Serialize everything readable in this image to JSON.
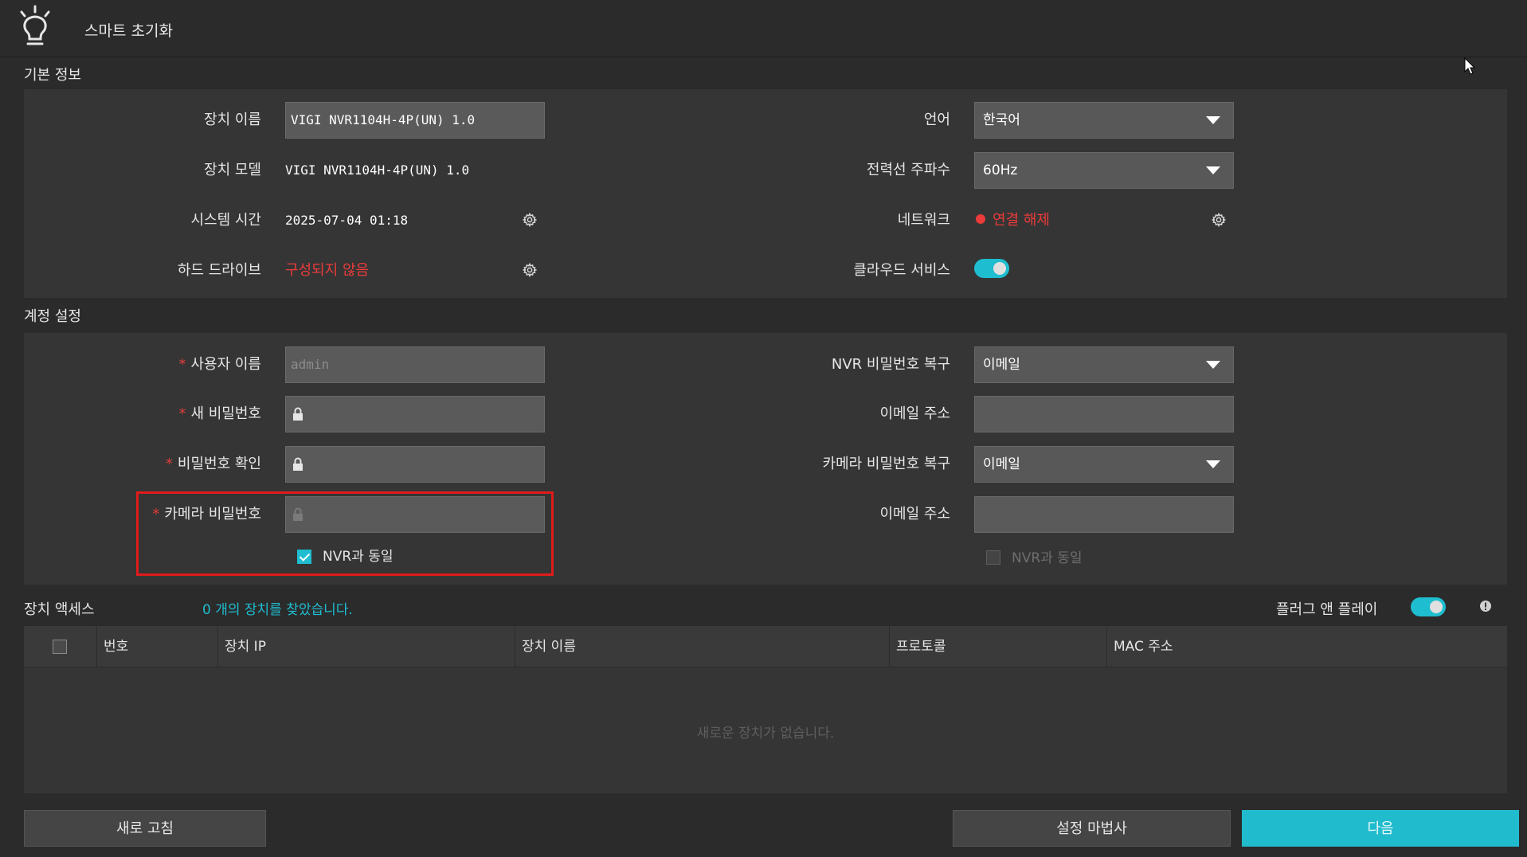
{
  "header": {
    "title": "스마트 초기화"
  },
  "basic_info": {
    "section_title": "기본 정보",
    "device_name": {
      "label": "장치 이름",
      "value": "VIGI NVR1104H-4P(UN) 1.0"
    },
    "device_model": {
      "label": "장치 모델",
      "value": "VIGI NVR1104H-4P(UN) 1.0"
    },
    "system_time": {
      "label": "시스템 시간",
      "value": "2025-07-04 01:18"
    },
    "hard_drive": {
      "label": "하드 드라이브",
      "value": "구성되지 않음"
    },
    "language": {
      "label": "언어",
      "value": "한국어"
    },
    "power_frequency": {
      "label": "전력선 주파수",
      "value": "60Hz"
    },
    "network": {
      "label": "네트워크",
      "value": "연결 해제"
    },
    "cloud_service": {
      "label": "클라우드 서비스",
      "enabled": true
    }
  },
  "account": {
    "section_title": "계정 설정",
    "required_mark": "*",
    "username": {
      "label": "사용자 이름",
      "value": "admin"
    },
    "new_password": {
      "label": "새 비밀번호",
      "value": ""
    },
    "confirm_password": {
      "label": "비밀번호 확인",
      "value": ""
    },
    "camera_password": {
      "label": "카메라 비밀번호",
      "value": ""
    },
    "same_as_nvr_left": {
      "label": "NVR과 동일",
      "checked": true
    },
    "nvr_recovery": {
      "label": "NVR 비밀번호 복구",
      "value": "이메일"
    },
    "email1": {
      "label": "이메일 주소",
      "value": ""
    },
    "camera_recovery": {
      "label": "카메라 비밀번호 복구",
      "value": "이메일"
    },
    "email2": {
      "label": "이메일 주소",
      "value": ""
    },
    "same_as_nvr_right": {
      "label": "NVR과 동일",
      "checked": false
    }
  },
  "device_access": {
    "section_title": "장치 액세스",
    "found_message": "0 개의 장치를 찾았습니다.",
    "plug_and_play": {
      "label": "플러그 앤 플레이",
      "enabled": true
    },
    "columns": [
      "번호",
      "장치 IP",
      "장치 이름",
      "프로토콜",
      "MAC 주소"
    ],
    "rows": [],
    "empty_message": "새로운 장치가 없습니다."
  },
  "footer": {
    "refresh_label": "새로 고침",
    "wizard_label": "설정 마법사",
    "next_label": "다음"
  },
  "colors": {
    "accent": "#1fbdd0",
    "error": "#ec3b3b",
    "highlight": "#e01b1b"
  }
}
